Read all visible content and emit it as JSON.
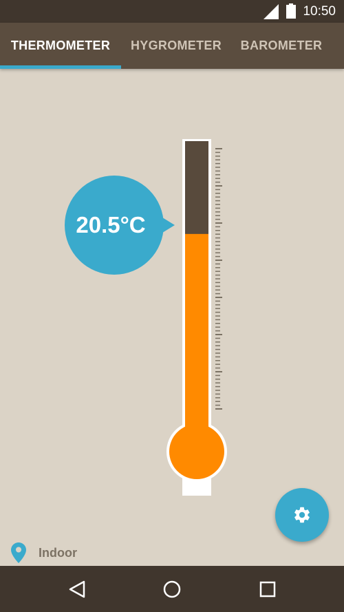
{
  "status_bar": {
    "time": "10:50",
    "signal_icon": "cell-signal-icon",
    "battery_icon": "battery-icon"
  },
  "tabs": [
    {
      "label": "THERMOMETER",
      "active": true
    },
    {
      "label": "HYGROMETER",
      "active": false
    },
    {
      "label": "BAROMETER",
      "active": false
    }
  ],
  "reading": {
    "value_label": "20.5°C",
    "fill_fraction": 0.69
  },
  "location": {
    "label": "Indoor",
    "icon": "location-pin-icon"
  },
  "fab": {
    "icon": "gear-icon"
  },
  "navigation": {
    "back_icon": "back-triangle-icon",
    "home_icon": "home-circle-icon",
    "recents_icon": "recents-square-icon"
  },
  "colors": {
    "accent": "#3aaacc",
    "mercury": "#ff8a00",
    "tube_empty": "#584a3c",
    "toolbar": "#5b4d3f",
    "background": "#dbd3c6"
  }
}
